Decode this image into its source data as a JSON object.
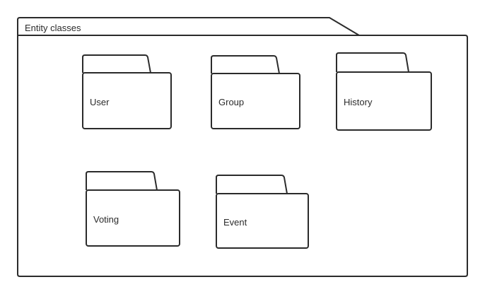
{
  "container": {
    "label": "Entity classes"
  },
  "packages": [
    {
      "name": "User"
    },
    {
      "name": "Group"
    },
    {
      "name": "History"
    },
    {
      "name": "Voting"
    },
    {
      "name": "Event"
    }
  ]
}
